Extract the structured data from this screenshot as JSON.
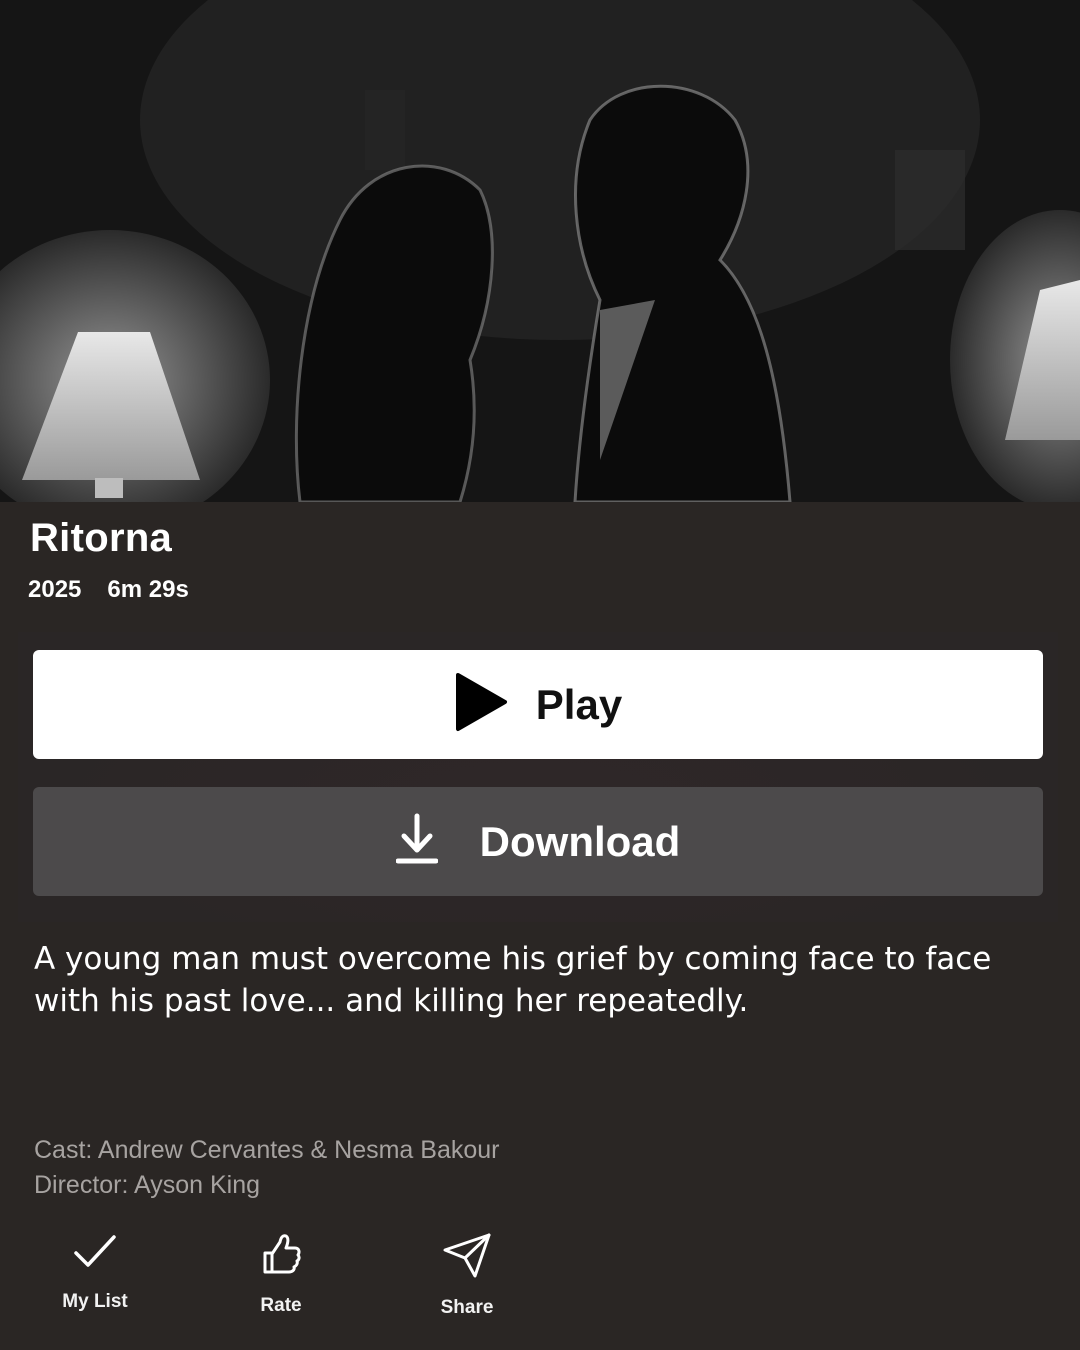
{
  "hero": {
    "image_description_icon": "still-image-icon"
  },
  "title": "Ritorna",
  "meta": {
    "year": "2025",
    "duration": "6m 29s"
  },
  "buttons": {
    "play_label": "Play",
    "play_icon": "play-icon",
    "download_label": "Download",
    "download_icon": "download-icon"
  },
  "synopsis": "A young man must overcome his grief by coming face to face with his past love... and killing her repeatedly.",
  "credits": {
    "cast": "Cast: Andrew Cervantes & Nesma Bakour",
    "director": "Director: Ayson King"
  },
  "actions": [
    {
      "label": "My List",
      "icon": "checkmark-icon"
    },
    {
      "label": "Rate",
      "icon": "thumbs-up-icon"
    },
    {
      "label": "Share",
      "icon": "paper-plane-icon"
    }
  ],
  "colors": {
    "background": "#2a2624",
    "play_bg": "#ffffff",
    "download_bg": "#4c4a4b",
    "credits_text": "#a7a3a1"
  }
}
